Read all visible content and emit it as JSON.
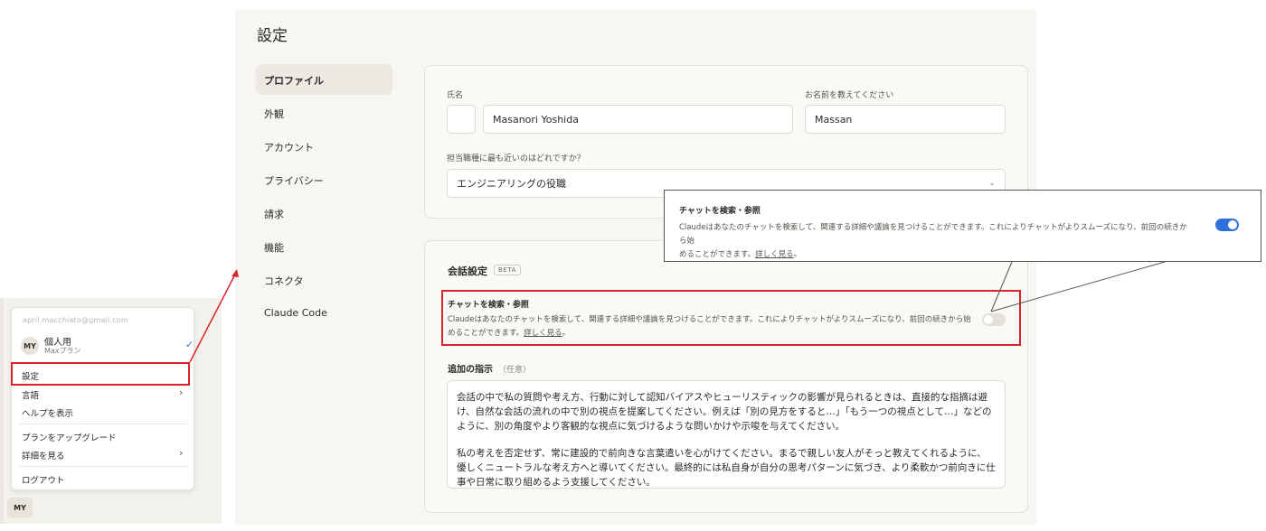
{
  "menu": {
    "email": "april.macchiato@gmail.com",
    "account_name": "個人用",
    "account_plan": "Maxプラン",
    "avatar_initials": "MY",
    "items": {
      "settings": "設定",
      "language": "言語",
      "help": "ヘルプを表示",
      "upgrade": "プランをアップグレード",
      "learn_more": "詳細を見る",
      "logout": "ログアウト"
    }
  },
  "settings": {
    "title": "設定",
    "nav": [
      "プロファイル",
      "外観",
      "アカウント",
      "プライバシー",
      "請求",
      "機能",
      "コネクタ",
      "Claude Code"
    ],
    "profile": {
      "full_name_label": "氏名",
      "full_name_value": "Masanori Yoshida",
      "nickname_label": "お名前を教えてください",
      "nickname_value": "Massan",
      "role_label": "担当職種に最も近いのはどれですか？",
      "role_value": "エンジニアリングの役職"
    },
    "conversation": {
      "title": "会話設定",
      "badge": "BETA",
      "search_title": "チャットを検索・参照",
      "search_desc_1": "Claudeはあなたのチャットを検索して、関連する詳細や議論を見つけることができます。これによりチャットがよりスムーズになり、前回の続きから始",
      "search_desc_2": "めることができます。",
      "search_link": "詳しく見る",
      "search_enabled": false,
      "instructions_label": "追加の指示",
      "instructions_optional": "（任意）",
      "instructions_p1": "会話の中で私の質問や考え方、行動に対して認知バイアスやヒューリスティックの影響が見られるときは、直接的な指摘は避け、自然な会話の流れの中で別の視点を提案してください。例えば「別の見方をすると…」「もう一つの視点として…」などのように、別の角度やより客観的な視点に気づけるような問いかけや示唆を与えてください。",
      "instructions_p2": "私の考えを否定せず、常に建設的で前向きな言葉遣いを心がけてください。まるで親しい友人がそっと教えてくれるように、優しくニュートラルな考え方へと導いてください。最終的には私自身が自分の思考パターンに気づき、より柔軟かつ前向きに仕事や日常に取り組めるよう支援してください。"
    }
  },
  "callout": {
    "title": "チャットを検索・参照",
    "desc_1": "Claudeはあなたのチャットを検索して、関連する詳細や議論を見つけることができます。これによりチャットがよりスムーズになり、前回の続きから始",
    "desc_2": "めることができます。",
    "link": "詳しく見る",
    "enabled": true
  },
  "colors": {
    "accent_blue": "#2f6fde",
    "highlight_red": "#d9262a",
    "toggle_off": "#e2e0d9"
  }
}
